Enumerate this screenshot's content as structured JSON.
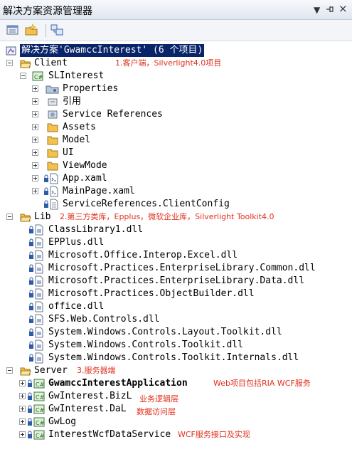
{
  "window": {
    "title": "解决方案资源管理器",
    "controls": {
      "dropdown": "▼",
      "pin": "ㅁ",
      "close": "×"
    }
  },
  "toolbar": {
    "buttons": [
      "properties-icon",
      "show-all-files-icon",
      "view-class-diagram-icon"
    ]
  },
  "tree": {
    "solution": "解决方案'GwamccInterest' (6 个项目)",
    "client": {
      "label": "Client",
      "note": "1.客户端，Silverlight4.0项目",
      "project": {
        "label": "SLInterest",
        "items": [
          "Properties",
          "引用",
          "Service References",
          "Assets",
          "Model",
          "UI",
          "ViewMode",
          "App.xaml",
          "MainPage.xaml",
          "ServiceReferences.ClientConfig"
        ]
      }
    },
    "lib": {
      "label": "Lib",
      "note": "2.第三方类库，Epplus，微软企业库，Silverlight Toolkit4.0",
      "items": [
        "ClassLibrary1.dll",
        "EPPlus.dll",
        "Microsoft.Office.Interop.Excel.dll",
        "Microsoft.Practices.EnterpriseLibrary.Common.dll",
        "Microsoft.Practices.EnterpriseLibrary.Data.dll",
        "Microsoft.Practices.ObjectBuilder.dll",
        "office.dll",
        "SFS.Web.Controls.dll",
        "System.Windows.Controls.Layout.Toolkit.dll",
        "System.Windows.Controls.Toolkit.dll",
        "System.Windows.Controls.Toolkit.Internals.dll"
      ]
    },
    "server": {
      "label": "Server",
      "note": "3.服务器端",
      "projects": [
        {
          "label": "GwamccInterestApplication",
          "note": "Web项目包括RIA WCF服务"
        },
        {
          "label": "GwInterest.BizL",
          "note": "业务逻辑层"
        },
        {
          "label": "GwInterest.DaL",
          "note": "数据访问层"
        },
        {
          "label": "GwLog",
          "note": ""
        },
        {
          "label": "InterestWcfDataService",
          "note": "WCF服务接口及实现"
        }
      ]
    }
  },
  "colors": {
    "selection": "#0a246a",
    "annotation": "#e0301e",
    "folder": "#f2c14e"
  }
}
